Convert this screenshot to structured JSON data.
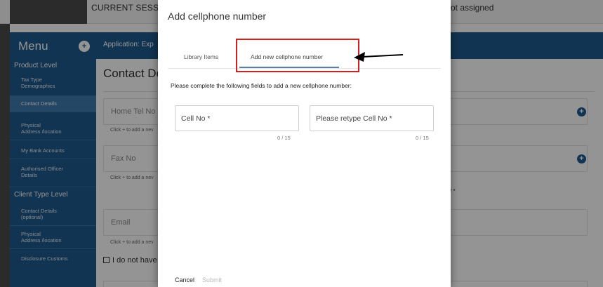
{
  "topbar": {
    "session_text": "CURRENT SESSIO",
    "assigned_text": "ot assigned"
  },
  "sidebar": {
    "menu_title": "Menu",
    "toggle_icon": "plus-circle-icon",
    "product_section": "Product Level",
    "product_items": [
      {
        "label": "Tax Type\nDemographics"
      },
      {
        "label": "Contact Details"
      },
      {
        "label": "Physical\nAddress /location"
      },
      {
        "label": "My Bank Accounts"
      },
      {
        "label": "Authorised Officer\nDetails"
      }
    ],
    "client_section": "Client Type Level",
    "client_items": [
      {
        "label": "Contact Details\n(optional)"
      },
      {
        "label": "Physical\nAddress /location"
      },
      {
        "label": "Disclosure Customs"
      }
    ]
  },
  "app_header": {
    "label": "Application: Exp"
  },
  "background": {
    "title": "Contact De",
    "home_tel": "Home Tel No",
    "home_hint": "Click + to add a nev",
    "fax": "Fax No",
    "fax_hint": "Click + to add a nev",
    "email": "Email",
    "email_hint": "Click + to add a nev",
    "checkbox_label": "I do not have",
    "star_text": "/ *"
  },
  "dialog": {
    "title": "Add cellphone number",
    "tabs": [
      {
        "label": "Library Items"
      },
      {
        "label": "Add new cellphone number"
      }
    ],
    "instructions": "Please complete the following fields to add a new cellphone number:",
    "cell_placeholder": "Cell No *",
    "cell_counter": "0 / 15",
    "retype_placeholder": "Please retype Cell No *",
    "retype_counter": "0 / 15",
    "cancel_label": "Cancel",
    "submit_label": "Submit"
  },
  "colors": {
    "brand_blue": "#1e5a8e",
    "highlight_red": "#d0201f",
    "tab_ink": "#5a7fa6"
  }
}
